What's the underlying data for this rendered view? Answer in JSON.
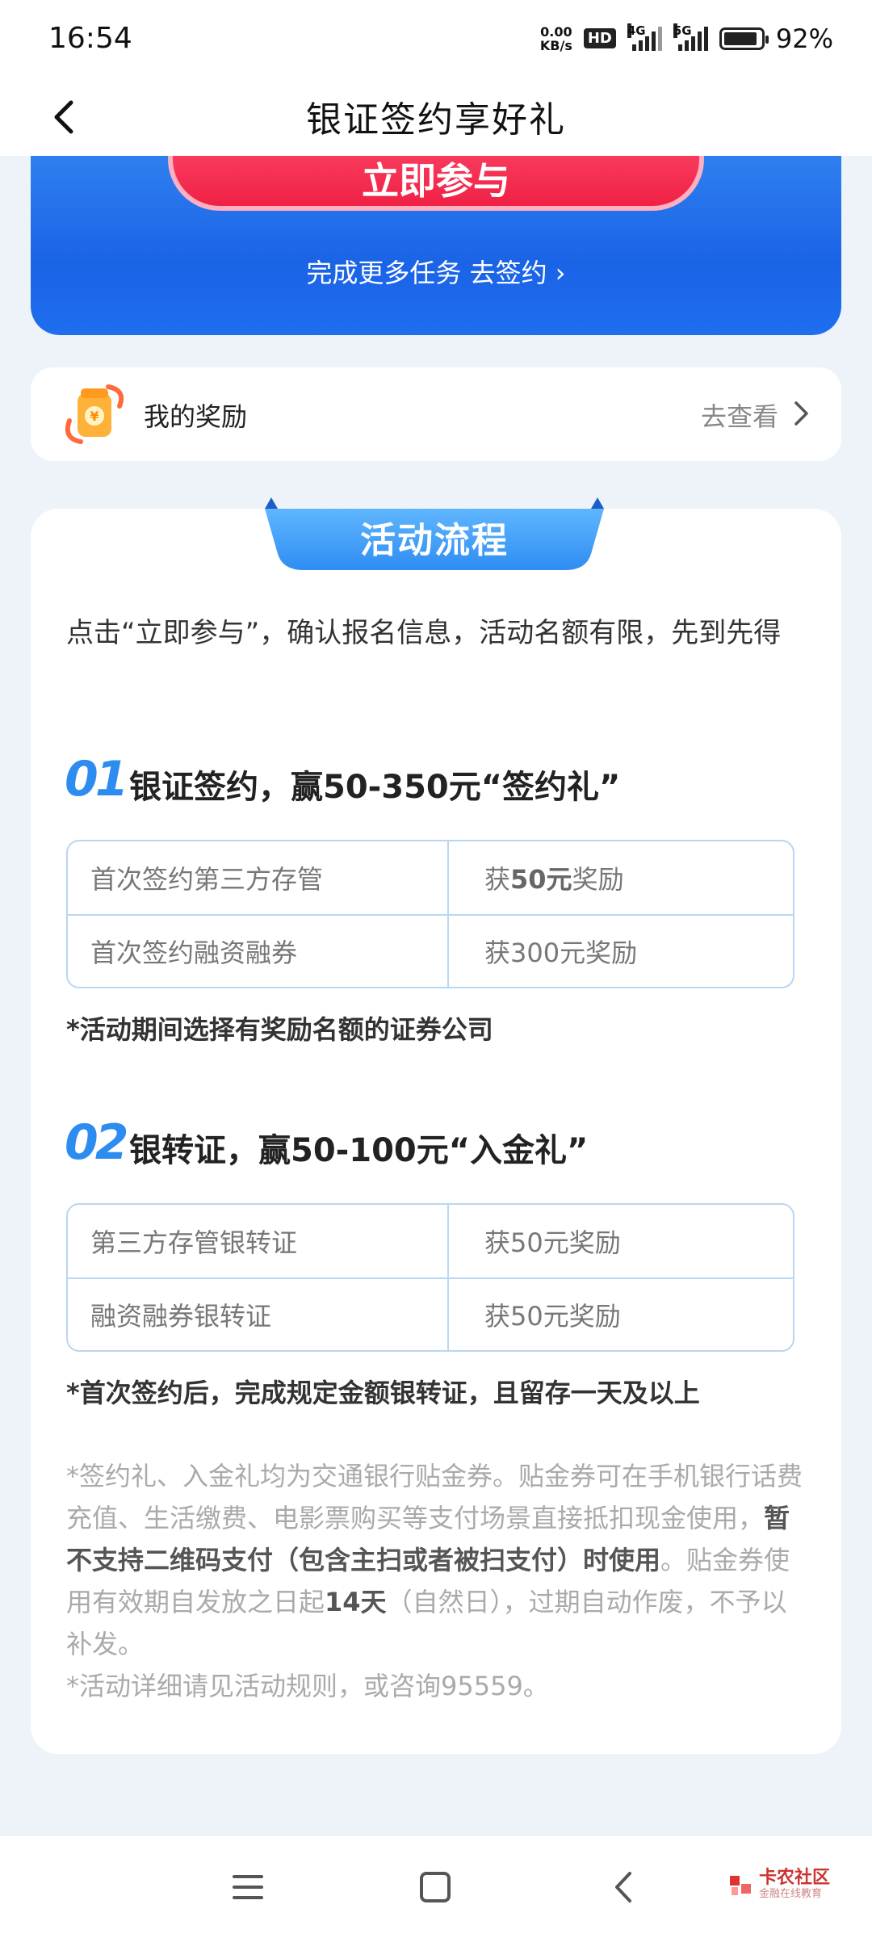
{
  "status_bar": {
    "time": "16:54",
    "net_speed_value": "0.00",
    "net_speed_unit": "KB/s",
    "hd_badge": "HD",
    "signal1_label": "4G",
    "signal2_label": "5G",
    "battery_text": "92%",
    "battery_level": 0.92
  },
  "header": {
    "title": "银证签约享好礼",
    "back_icon": "chevron-left-icon"
  },
  "banner": {
    "join_label": "立即参与",
    "more_task_label": "完成更多任务 去签约 ›"
  },
  "reward_card": {
    "icon": "gift-pouch-icon",
    "label": "我的奖励",
    "link_label": "去查看"
  },
  "flow": {
    "tab_title": "活动流程",
    "intro": "点击“立即参与”，确认报名信息，活动名额有限，先到先得",
    "steps": [
      {
        "number": "01",
        "title": "银证签约，赢50-350元“签约礼”",
        "rows": [
          {
            "item": "首次签约第三方存管",
            "reward_prefix": "获",
            "reward_amount": "50元",
            "reward_suffix": "奖励"
          },
          {
            "item": "首次签约融资融券",
            "reward_prefix": "获",
            "reward_amount": "300元",
            "reward_suffix": "奖励"
          }
        ],
        "note": "*活动期间选择有奖励名额的证券公司"
      },
      {
        "number": "02",
        "title": "银转证，赢50-100元“入金礼”",
        "rows": [
          {
            "item": "第三方存管银转证",
            "reward_prefix": "获",
            "reward_amount": "50元",
            "reward_suffix": "奖励"
          },
          {
            "item": "融资融券银转证",
            "reward_prefix": "获",
            "reward_amount": "50元",
            "reward_suffix": "奖励"
          }
        ],
        "note": "*首次签约后，完成规定金额银转证，且留存一天及以上"
      }
    ],
    "fine_print": {
      "p1_a": "*签约礼、入金礼均为交通银行贴金券。贴金券可在手机银行话费充值、生活缴费、电影票购买等支付场景直接抵扣现金使用，",
      "p1_b": "暂不支持二维码支付（包含主扫或者被扫支付）时使用",
      "p1_c": "。贴金券使用有效期自发放之日起",
      "p1_d": "14天",
      "p1_e": "（自然日），过期自动作废，不予以补发。",
      "p2": "*活动详细请见活动规则，或咨询95559。"
    }
  },
  "nav_bar": {
    "menu_icon": "menu-icon",
    "home_icon": "home-square-icon",
    "back_icon": "back-triangle-icon",
    "watermark_title": "卡农社区",
    "watermark_sub": "金融在线教育"
  }
}
